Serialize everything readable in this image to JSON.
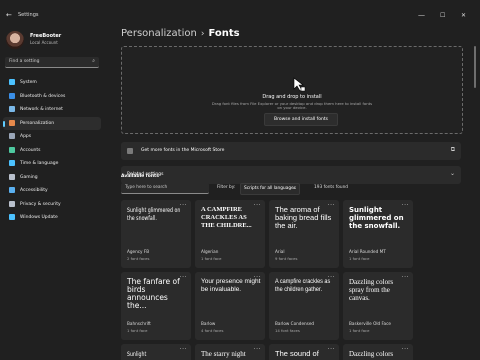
{
  "window": {
    "title": "Settings",
    "back_glyph": "←",
    "minimize_glyph": "—",
    "maximize_glyph": "☐",
    "close_glyph": "✕"
  },
  "user": {
    "name": "FreeBooter",
    "account": "Local Account"
  },
  "search": {
    "placeholder": "Find a setting"
  },
  "sidebar": {
    "items": [
      {
        "label": "System",
        "color": "#4cc2ff"
      },
      {
        "label": "Bluetooth & devices",
        "color": "#3a8ee6"
      },
      {
        "label": "Network & internet",
        "color": "#7ab8e8"
      },
      {
        "label": "Personalization",
        "color": "#e88a4c",
        "active": true
      },
      {
        "label": "Apps",
        "color": "#9aa6b8"
      },
      {
        "label": "Accounts",
        "color": "#4ec9a0"
      },
      {
        "label": "Time & language",
        "color": "#4cc2ff"
      },
      {
        "label": "Gaming",
        "color": "#b9c0cc"
      },
      {
        "label": "Accessibility",
        "color": "#5ab0f0"
      },
      {
        "label": "Privacy & security",
        "color": "#b9c0cc"
      },
      {
        "label": "Windows Update",
        "color": "#4cc2ff"
      }
    ]
  },
  "breadcrumb": {
    "parent": "Personalization",
    "separator": "›",
    "current": "Fonts"
  },
  "dropzone": {
    "title": "Drag and drop to install",
    "subtitle_1": "Drag font files from File Explorer or your desktop and drop them here to install fonts",
    "subtitle_2": "on your device.",
    "browse_label": "Browse and install fonts"
  },
  "store_link": {
    "label": "Get more fonts in the Microsoft Store",
    "icon": "external-link-icon"
  },
  "related": {
    "label": "Related settings"
  },
  "available": {
    "heading": "Available fonts",
    "type_placeholder": "Type here to search",
    "filter_label": "Filter by:",
    "filter_value": "Scripts for all languages",
    "count": "193 fonts found"
  },
  "fonts": [
    {
      "sample": "Sunlight glimmered on the snowfall.",
      "name": "Agency FB",
      "faces": "2 font faces",
      "style": "agency"
    },
    {
      "sample": "A CAMPFIRE CRACKLES AS THE CHILDRE...",
      "name": "Algerian",
      "faces": "1 font face",
      "style": "algerian"
    },
    {
      "sample": "The aroma of baking bread fills the air.",
      "name": "Arial",
      "faces": "9 font faces",
      "style": "arial"
    },
    {
      "sample": "Sunlight glimmered on the snowfall.",
      "name": "Arial Rounded MT",
      "faces": "1 font face",
      "style": "rounded"
    },
    {
      "sample": "The fanfare of birds announces the...",
      "name": "Bahnschrift",
      "faces": "1 font face",
      "style": "bahn"
    },
    {
      "sample": "Your presence might be invaluable.",
      "name": "Barlow",
      "faces": "4 font faces",
      "style": "barlow"
    },
    {
      "sample": "A campfire crackles as the children gather.",
      "name": "Barlow Condensed",
      "faces": "14 font faces",
      "style": "barlowc"
    },
    {
      "sample": "Dazzling colors spray from the canvas.",
      "name": "Baskerville Old Face",
      "faces": "1 font face",
      "style": "bask"
    },
    {
      "sample": "Sunlight",
      "name": "",
      "faces": "",
      "style": "agency"
    },
    {
      "sample": "The starry night",
      "name": "",
      "faces": "",
      "style": "bask"
    },
    {
      "sample": "The sound of",
      "name": "",
      "faces": "",
      "style": "arial"
    },
    {
      "sample": "Dazzling colors",
      "name": "",
      "faces": "",
      "style": "bask"
    }
  ]
}
